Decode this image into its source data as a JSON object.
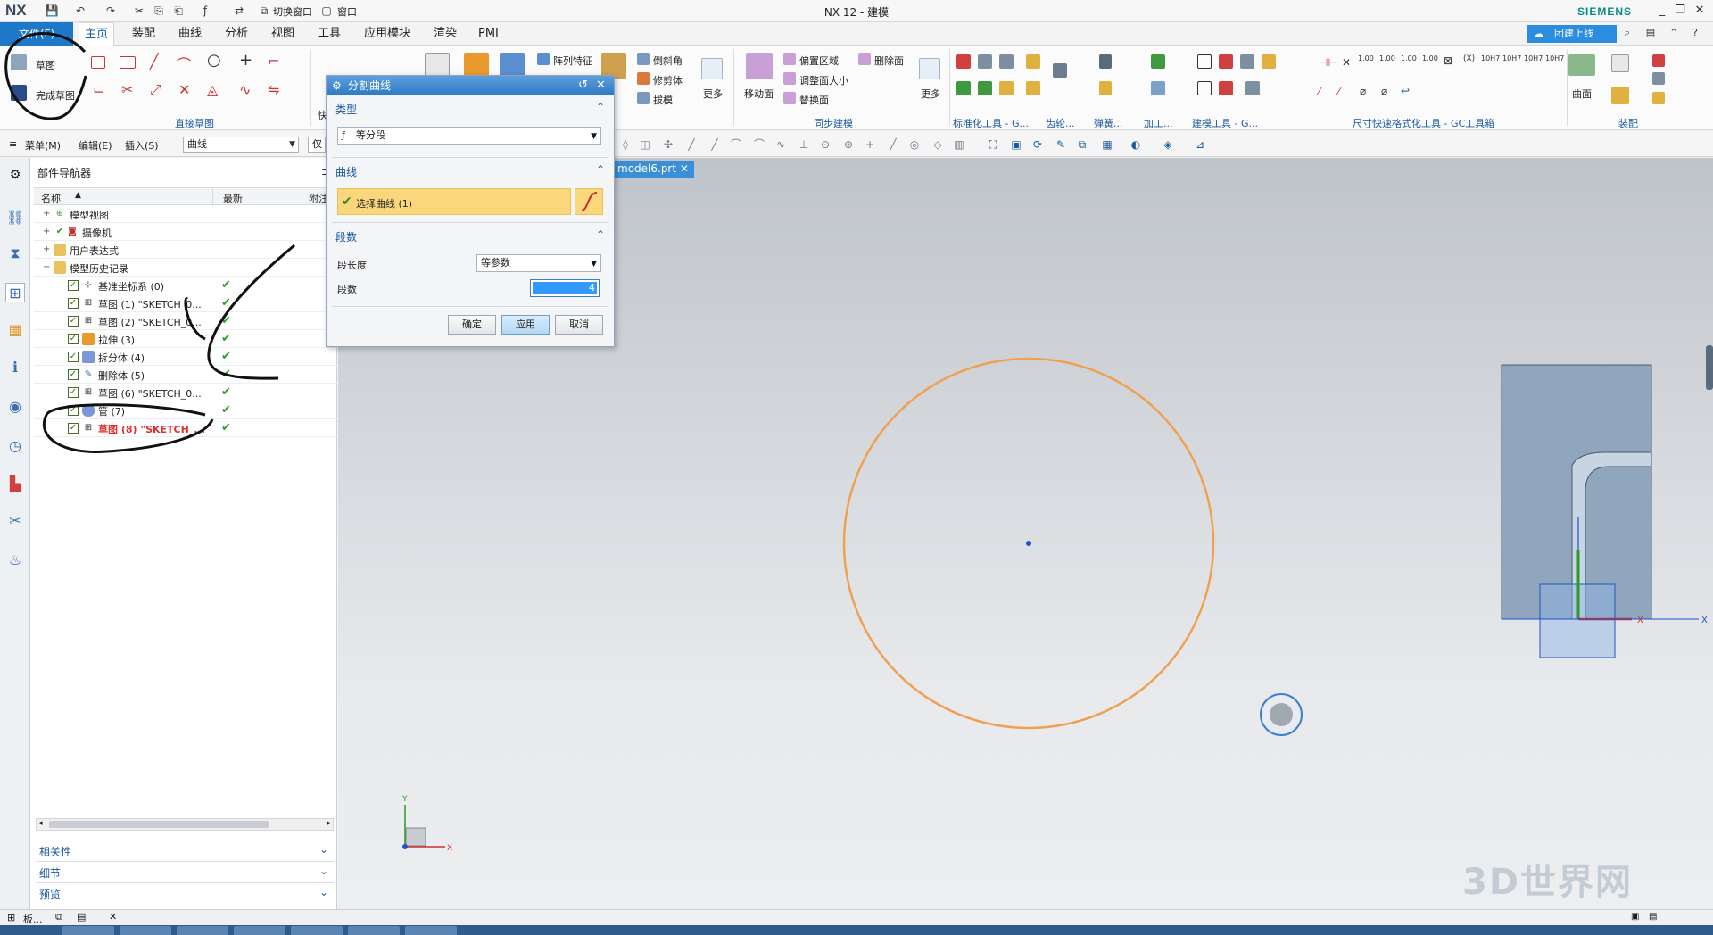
{
  "titlebar": {
    "logo": "NX",
    "title": "NX 12 - 建模",
    "brand": "SIEMENS",
    "switch_window": "切换窗口",
    "window_menu": "窗口",
    "min": "_",
    "restore": "❐",
    "close": "✕"
  },
  "tabs": {
    "file": "文件(F)",
    "items": [
      "主页",
      "装配",
      "曲线",
      "分析",
      "视图",
      "工具",
      "应用模块",
      "渲染",
      "PMI"
    ],
    "cloud_label": "团建上线"
  },
  "ribbon": {
    "sketch": "草图",
    "finish_sketch": "完成草图",
    "direct_sketch_group": "直接草图",
    "array_feature": "阵列特征",
    "chamfer": "倒斜角",
    "trim_body": "修剪体",
    "draft": "拔模",
    "more": "更多",
    "move_face": "移动面",
    "offset_region": "偏置区域",
    "resize_face": "调整面大小",
    "replace_face": "替换面",
    "delete_face": "删除面",
    "sync_modeling_group": "同步建模",
    "more2": "更多",
    "standardize_group": "标准化工具 - G...",
    "gear_group": "齿轮...",
    "spring_group": "弹簧...",
    "machining_group": "加工...",
    "modeling_tools_group": "建模工具 - G...",
    "dim_tools_group": "尺寸快速格式化工具 - GC工具箱",
    "surface": "曲面",
    "assembly_group": "装配",
    "fast_label": "快"
  },
  "cmdbar": {
    "menu": "菜单(M)",
    "edit": "编辑(E)",
    "insert": "插入(S)",
    "filter_value": "曲线",
    "scope_value": "仅"
  },
  "navigator": {
    "title": "部件导航器",
    "col_name": "名称",
    "col_latest": "最新",
    "col_attached": "附注",
    "rows": [
      {
        "label": "模型视图",
        "level": 0,
        "expand": "+",
        "has_check": false,
        "latest": ""
      },
      {
        "label": "摄像机",
        "level": 0,
        "expand": "+",
        "has_check": false,
        "latest": ""
      },
      {
        "label": "用户表达式",
        "level": 0,
        "expand": "+",
        "has_check": false,
        "latest": ""
      },
      {
        "label": "模型历史记录",
        "level": 0,
        "expand": "-",
        "has_check": false,
        "latest": ""
      },
      {
        "label": "基准坐标系 (0)",
        "level": 1,
        "expand": "",
        "has_check": true,
        "latest": "✔"
      },
      {
        "label": "草图 (1) \"SKETCH_0...",
        "level": 1,
        "expand": "",
        "has_check": true,
        "latest": "✔"
      },
      {
        "label": "草图 (2) \"SKETCH_0...",
        "level": 1,
        "expand": "",
        "has_check": true,
        "latest": "✔"
      },
      {
        "label": "拉伸 (3)",
        "level": 1,
        "expand": "",
        "has_check": true,
        "latest": "✔"
      },
      {
        "label": "拆分体 (4)",
        "level": 1,
        "expand": "",
        "has_check": true,
        "latest": "✔"
      },
      {
        "label": "删除体 (5)",
        "level": 1,
        "expand": "",
        "has_check": true,
        "latest": "✔"
      },
      {
        "label": "草图 (6) \"SKETCH_0...",
        "level": 1,
        "expand": "",
        "has_check": true,
        "latest": "✔"
      },
      {
        "label": "管 (7)",
        "level": 1,
        "expand": "",
        "has_check": true,
        "latest": "✔"
      },
      {
        "label": "草图 (8) \"SKETCH_...",
        "level": 1,
        "expand": "",
        "has_check": true,
        "latest": "✔",
        "highlight": true
      }
    ],
    "sections": [
      "相关性",
      "细节",
      "预览"
    ]
  },
  "document_tab": "model6.prt",
  "dialog": {
    "title": "分割曲线",
    "section_type": "类型",
    "type_value": "等分段",
    "section_curve": "曲线",
    "select_curve": "选择曲线 (1)",
    "section_segments": "段数",
    "segment_length_label": "段长度",
    "segment_length_value": "等参数",
    "segment_count_label": "段数",
    "segment_count_value": "4",
    "ok": "确定",
    "apply": "应用",
    "cancel": "取消"
  },
  "statusbar": {
    "left_label": "板..."
  },
  "watermark": "3D世界网",
  "colors": {
    "accent": "#1e78c8",
    "curve": "#f0a050",
    "highlight": "#fbd77c"
  }
}
